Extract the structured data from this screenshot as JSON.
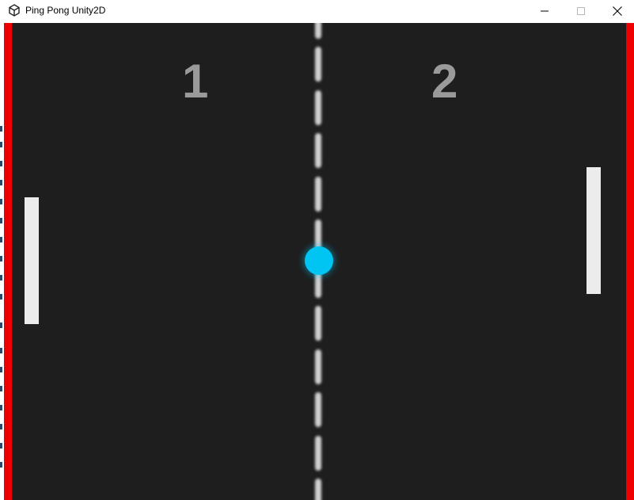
{
  "window": {
    "title": "Ping Pong Unity2D",
    "icon": "unity-icon",
    "controls": [
      "minimize-icon",
      "maximize-icon",
      "close-icon"
    ]
  },
  "game": {
    "scores": {
      "left": "1",
      "right": "2"
    },
    "colors": {
      "background": "#1e1e1e",
      "walls": "#ee0000",
      "paddles": "#ececec",
      "ball": "#00c4f2",
      "score_text": "#9a9a9a",
      "center_line": "#d0d0d0"
    }
  }
}
